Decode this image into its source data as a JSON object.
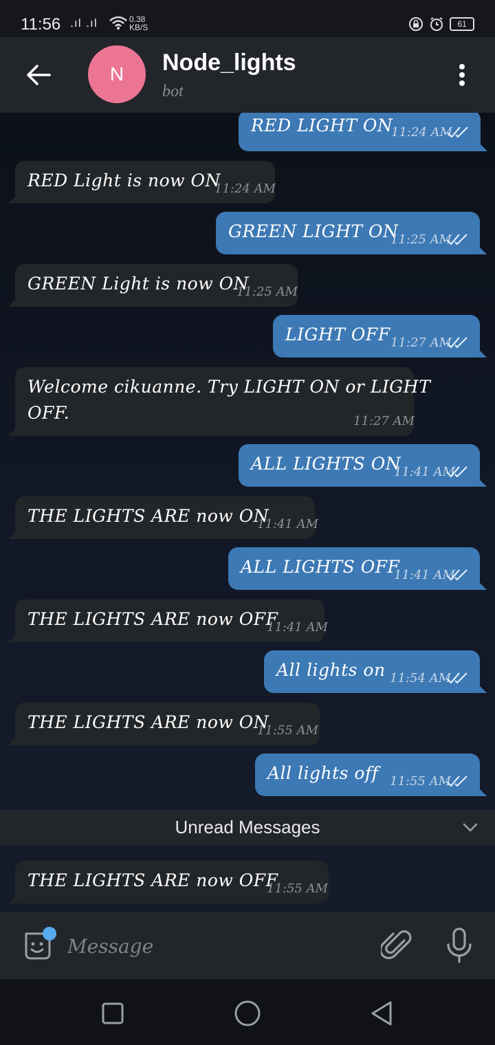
{
  "status_bar": {
    "time": "11:56",
    "signal": ".ıl .ıl",
    "speed_value": "0.38",
    "speed_unit": "KB/S",
    "battery": "61"
  },
  "header": {
    "avatar_letter": "N",
    "title": "Node_lights",
    "subtitle": "bot",
    "avatar_color": "#ed7594"
  },
  "messages": [
    {
      "dir": "out",
      "text": "RED LIGHT ON",
      "time": "11:24 AM"
    },
    {
      "dir": "in",
      "text": "RED Light is now ON",
      "time": "11:24 AM"
    },
    {
      "dir": "out",
      "text": "GREEN LIGHT ON",
      "time": "11:25 AM"
    },
    {
      "dir": "in",
      "text": "GREEN Light is now ON",
      "time": "11:25 AM"
    },
    {
      "dir": "out",
      "text": "LIGHT OFF",
      "time": "11:27 AM"
    },
    {
      "dir": "in",
      "text_line1": "Welcome cikuanne. Try LIGHT ON or LIGHT",
      "text_line2": "OFF.",
      "time": "11:27 AM"
    },
    {
      "dir": "out",
      "text": "ALL LIGHTS ON",
      "time": "11:41 AM"
    },
    {
      "dir": "in",
      "text": "THE LIGHTS ARE now ON",
      "time": "11:41 AM"
    },
    {
      "dir": "out",
      "text": "ALL LIGHTS OFF",
      "time": "11:41 AM"
    },
    {
      "dir": "in",
      "text": "THE LIGHTS ARE now OFF",
      "time": "11:41 AM"
    },
    {
      "dir": "out",
      "text": "All lights on",
      "time": "11:54 AM"
    },
    {
      "dir": "in",
      "text": "THE LIGHTS ARE now ON",
      "time": "11:55 AM"
    },
    {
      "dir": "out",
      "text": "All lights off",
      "time": "11:55 AM"
    },
    {
      "dir": "in",
      "text": "THE LIGHTS ARE now OFF",
      "time": "11:55 AM"
    }
  ],
  "unread": {
    "label": "Unread Messages"
  },
  "input": {
    "placeholder": "Message"
  },
  "colors": {
    "outgoing_bubble": "#3d79b4",
    "incoming_bubble": "#232629",
    "sticker_badge": "#58a8ee"
  }
}
